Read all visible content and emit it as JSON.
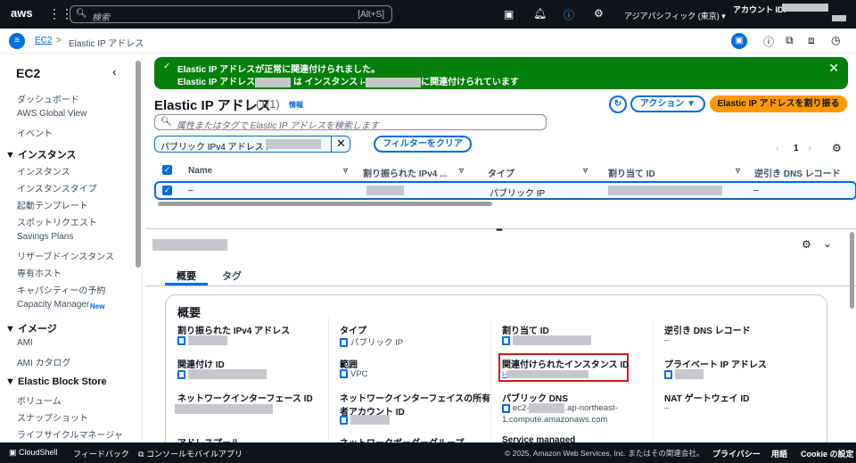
{
  "topnav": {
    "logo": "aws",
    "search_placeholder": "検索",
    "search_shortcut": "[Alt+S]",
    "region": "アジアパシフィック (東京) ▾",
    "account_label": "アカウント ID:"
  },
  "breadcrumb": {
    "root": "EC2",
    "sep": ">",
    "current": "Elastic IP アドレス"
  },
  "sidebar": {
    "title": "EC2",
    "items": [
      {
        "label": "ダッシュボード",
        "type": "item"
      },
      {
        "label": "AWS Global View",
        "type": "item"
      },
      {
        "label": "イベント",
        "type": "item"
      },
      {
        "label": "▼ インスタンス",
        "type": "head"
      },
      {
        "label": "インスタンス",
        "type": "item"
      },
      {
        "label": "インスタンスタイプ",
        "type": "item"
      },
      {
        "label": "起動テンプレート",
        "type": "item"
      },
      {
        "label": "スポットリクエスト",
        "type": "item"
      },
      {
        "label": "Savings Plans",
        "type": "item"
      },
      {
        "label": "リザーブドインスタンス",
        "type": "item"
      },
      {
        "label": "専有ホスト",
        "type": "item"
      },
      {
        "label": "キャパシティーの予約",
        "type": "item"
      },
      {
        "label": "Capacity Manager",
        "type": "item"
      },
      {
        "label": "▼ イメージ",
        "type": "head"
      },
      {
        "label": "AMI",
        "type": "item"
      },
      {
        "label": "AMI カタログ",
        "type": "item"
      },
      {
        "label": "▼ Elastic Block Store",
        "type": "head"
      },
      {
        "label": "ボリューム",
        "type": "item"
      },
      {
        "label": "スナップショット",
        "type": "item"
      },
      {
        "label": "ライフサイクルマネージャ",
        "type": "item"
      }
    ],
    "new_badge": "New"
  },
  "flash": {
    "title": "Elastic IP アドレスが正常に関連付けられました。",
    "line_a": "Elastic IP アドレス",
    "line_b": "は インスタンス i-",
    "line_c": "に関連付けられています",
    "color": "#037f0c"
  },
  "list": {
    "title": "Elastic IP アドレス",
    "count": "(1/1)",
    "info": "情報",
    "actions": "アクション ▼",
    "allocate": "Elastic IP アドレスを割り振る",
    "search_placeholder": "属性またはタグで Elastic IP アドレスを検索します",
    "filter_token": "パブリック IPv4 アドレス :",
    "clear_filters": "フィルターをクリア",
    "page": "1",
    "columns": [
      "Name",
      "割り振られた IPv4 ...",
      "タイプ",
      "割り当て ID",
      "逆引き DNS レコード"
    ],
    "row": {
      "name": "–",
      "type": "パブリック IP",
      "dns": "–"
    }
  },
  "detail": {
    "tabs": [
      "概要",
      "タグ"
    ],
    "section": "概要",
    "fields": [
      {
        "label": "割り振られた IPv4 アドレス"
      },
      {
        "label": "タイプ",
        "value": "パブリック IP"
      },
      {
        "label": "割り当て ID"
      },
      {
        "label": "逆引き DNS レコード",
        "value": "–"
      },
      {
        "label": "関連付け ID"
      },
      {
        "label": "範囲",
        "value": "VPC"
      },
      {
        "label": "関連付けられたインスタンス ID",
        "value": "i-"
      },
      {
        "label": "プライベート IP アドレス"
      },
      {
        "label": "ネットワークインターフェース ID"
      },
      {
        "label": "ネットワークインターフェイスの所有者アカウント ID"
      },
      {
        "label": "パブリック DNS",
        "value": "ec2-",
        "value2": ".ap-northeast-",
        "value3": "1.compute.amazonaws.com"
      },
      {
        "label": "NAT ゲートウェイ ID",
        "value": "–"
      },
      {
        "label": "アドレスプール"
      },
      {
        "label": "ネットワークボーダーグループ"
      },
      {
        "label": "Service managed"
      }
    ]
  },
  "footer": {
    "cloudshell": "CloudShell",
    "feedback": "フィードバック",
    "mobile": "コンソールモバイルアプリ",
    "copyright": "© 2025, Amazon Web Services, Inc. またはその関連会社。",
    "privacy": "プライバシー",
    "terms": "用語",
    "cookie": "Cookie の設定"
  }
}
